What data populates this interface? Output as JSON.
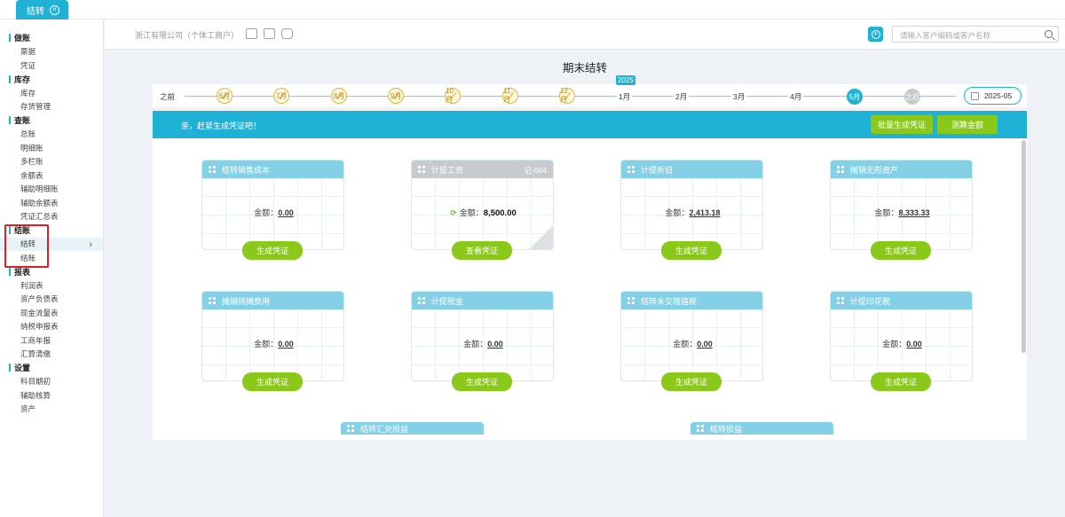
{
  "tab": {
    "label": "结转"
  },
  "sidebar": {
    "sections": [
      {
        "title": "做账",
        "items": [
          "票据",
          "凭证"
        ]
      },
      {
        "title": "库存",
        "items": [
          "库存",
          "存货管理"
        ]
      },
      {
        "title": "查账",
        "items": [
          "总账",
          "明细账",
          "多栏账",
          "余额表",
          "辅助明细账",
          "辅助余额表",
          "凭证汇总表"
        ]
      },
      {
        "title": "结账",
        "items": [
          "结转",
          "结账"
        ]
      },
      {
        "title": "报表",
        "items": [
          "利润表",
          "资产负债表",
          "现金流量表",
          "纳税申报表",
          "工商年报",
          "汇算清缴"
        ]
      },
      {
        "title": "设置",
        "items": [
          "科目期初",
          "辅助核算",
          "资产"
        ]
      }
    ],
    "active_item": "结转"
  },
  "header": {
    "company": "浙江有限公司（个体工商户）",
    "search_placeholder": "请输入客户编码或客户名称"
  },
  "page_title": "期末结转",
  "timeline": {
    "start_label": "之前",
    "year_badge": "2025",
    "completed": [
      "6月",
      "7月",
      "8月",
      "9月",
      "10月",
      "11月",
      "12月"
    ],
    "months": [
      "1月",
      "2月",
      "3月",
      "4月"
    ],
    "current": "5月",
    "after_label": "之后",
    "period": "2025-05"
  },
  "banner": {
    "text": "亲，赶紧生成凭证吧！",
    "batch_button": "批量生成凭证",
    "calc_button": "测算金额"
  },
  "cards": [
    {
      "title": "结转销售成本",
      "amount_label": "金额：",
      "amount": "0.00",
      "button": "生成凭证"
    },
    {
      "title": "计提工资",
      "code": "记-004",
      "amount_label": "金额：",
      "amount": "8,500.00",
      "button": "查看凭证"
    },
    {
      "title": "计提折旧",
      "amount_label": "金额：",
      "amount": "2,413.18",
      "button": "生成凭证"
    },
    {
      "title": "摊销无形资产",
      "amount_label": "金额：",
      "amount": "8,333.33",
      "button": "生成凭证"
    },
    {
      "title": "摊销待摊费用",
      "amount_label": "金额：",
      "amount": "0.00",
      "button": "生成凭证"
    },
    {
      "title": "计提税金",
      "amount_label": "金额：",
      "amount": "0.00",
      "button": "生成凭证"
    },
    {
      "title": "结转未交增值税",
      "amount_label": "金额：",
      "amount": "0.00",
      "button": "生成凭证"
    },
    {
      "title": "计提印花税",
      "amount_label": "金额：",
      "amount": "0.00",
      "button": "生成凭证"
    }
  ],
  "partial_cards": [
    "结转汇兑损益",
    "结转损益"
  ],
  "colors": {
    "accent": "#1fb2d6",
    "green": "#8ac81a",
    "highlight_box": "#e02020"
  }
}
